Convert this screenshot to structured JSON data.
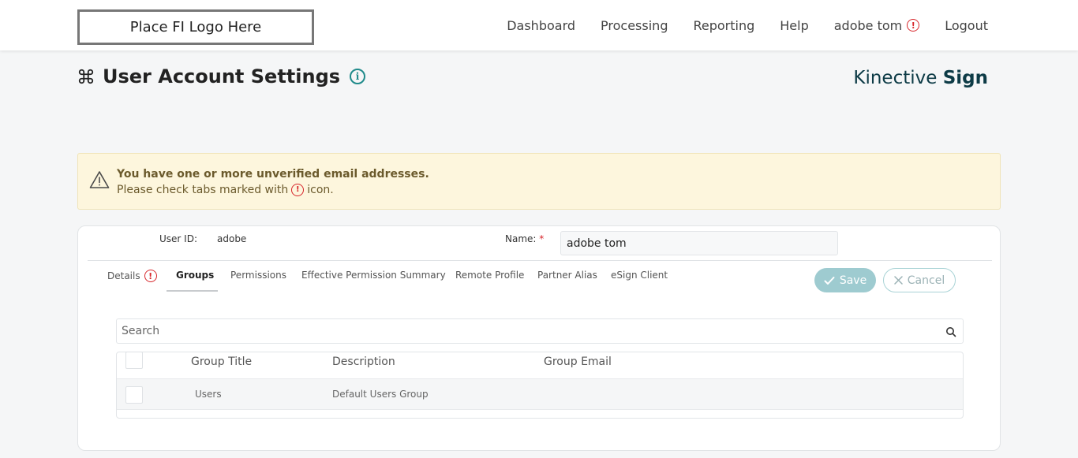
{
  "header": {
    "logo_text": "Place FI Logo Here",
    "nav": {
      "dashboard": "Dashboard",
      "processing": "Processing",
      "reporting": "Reporting",
      "help": "Help",
      "user": "adobe tom",
      "logout": "Logout"
    },
    "alert_symbol": "!"
  },
  "page": {
    "title": "User Account Settings",
    "title_icon": "command-icon",
    "info_symbol": "i",
    "brand_light": "Kinective",
    "brand_bold": "Sign"
  },
  "banner": {
    "title": "You have one or more unverified email addresses.",
    "text_before": "Please check tabs marked with",
    "text_after": "icon.",
    "alert_symbol": "!"
  },
  "form": {
    "user_id_label": "User ID:",
    "user_id_value": "adobe",
    "name_label": "Name:",
    "name_required_mark": "*",
    "name_value": "adobe tom"
  },
  "tabs": [
    {
      "label": "Details",
      "has_alert": true,
      "alert_symbol": "!"
    },
    {
      "label": "Groups",
      "active": true
    },
    {
      "label": "Permissions"
    },
    {
      "label": "Effective Permission Summary"
    },
    {
      "label": "Remote Profile"
    },
    {
      "label": "Partner Alias"
    },
    {
      "label": "eSign Client"
    }
  ],
  "actions": {
    "save_label": "Save",
    "cancel_label": "Cancel"
  },
  "search": {
    "placeholder": "Search",
    "value": ""
  },
  "table": {
    "columns": [
      "Group Title",
      "Description",
      "Group Email"
    ],
    "rows": [
      {
        "title": "Users",
        "description": "Default Users Group",
        "email": "",
        "checked": false
      }
    ]
  },
  "colors": {
    "accent": "#1f8a8a",
    "alert": "#d7262b",
    "banner_bg": "#fdf6dd",
    "brand": "#0d3b46"
  }
}
